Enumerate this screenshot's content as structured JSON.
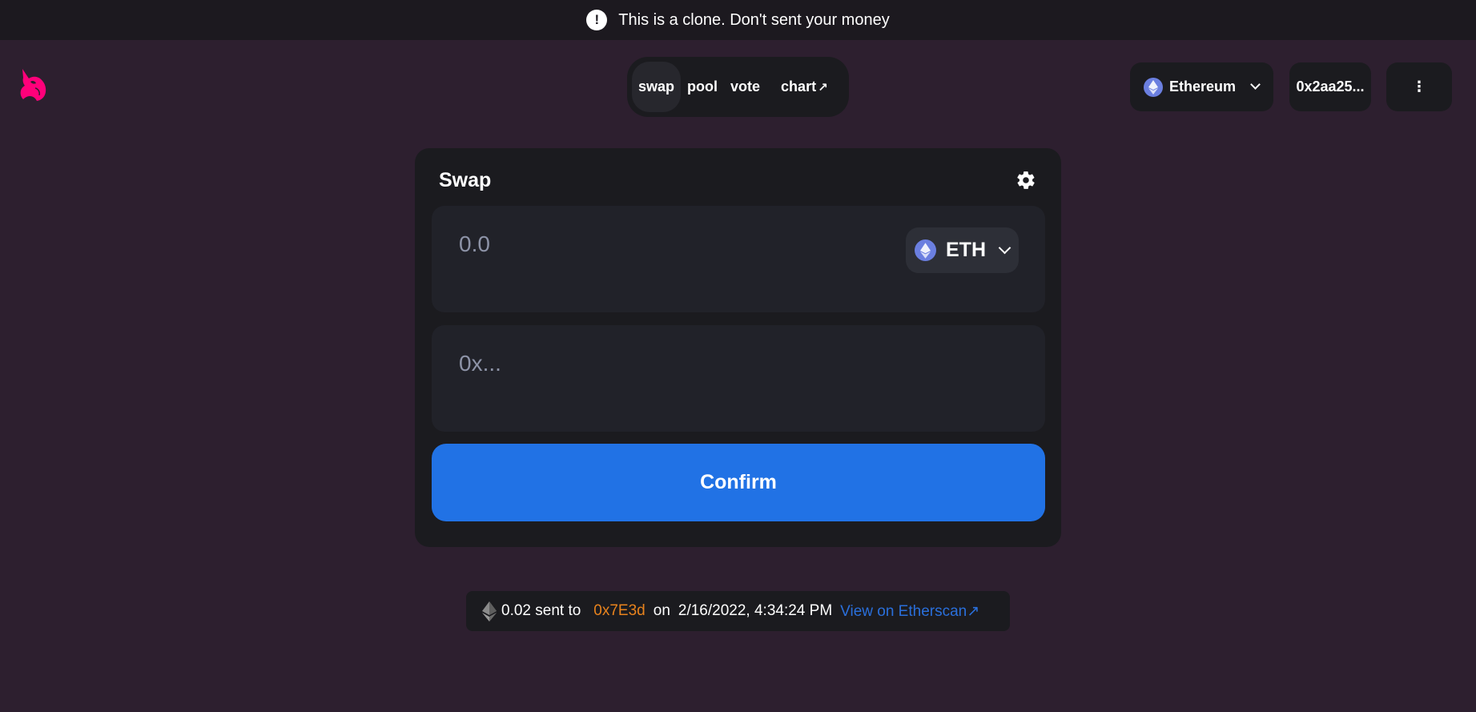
{
  "banner": {
    "icon": "exclamation-icon",
    "icon_text": "!",
    "text": "This is a clone. Don't sent your money"
  },
  "header": {
    "logo_icon": "uniswap-unicorn-icon",
    "nav": [
      {
        "label": "swap",
        "active": true
      },
      {
        "label": "pool",
        "active": false
      },
      {
        "label": "vote",
        "active": false
      },
      {
        "label": "chart",
        "external": true
      }
    ],
    "external_arrow": "↗",
    "network": {
      "label": "Ethereum",
      "icon": "ethereum-icon"
    },
    "account": "0x2aa25...",
    "menu_icon": "⋮"
  },
  "swap": {
    "title": "Swap",
    "settings_icon": "gear-icon",
    "amount_placeholder": "0.0",
    "token": "ETH",
    "address_placeholder": "0x...",
    "confirm_label": "Confirm"
  },
  "transaction": {
    "amount": "0.02 sent to",
    "address": "0x7E3d",
    "on": "on",
    "date": "2/16/2022, 4:34:24 PM",
    "link": "View on Etherscan",
    "link_arrow": "↗"
  },
  "colors": {
    "background": "#2d1f2f",
    "panel": "#1b1b1f",
    "field": "#212229",
    "accent": "#2172e5",
    "logo": "#ff007a",
    "address": "#e8831d",
    "link": "#2a6fdb"
  }
}
